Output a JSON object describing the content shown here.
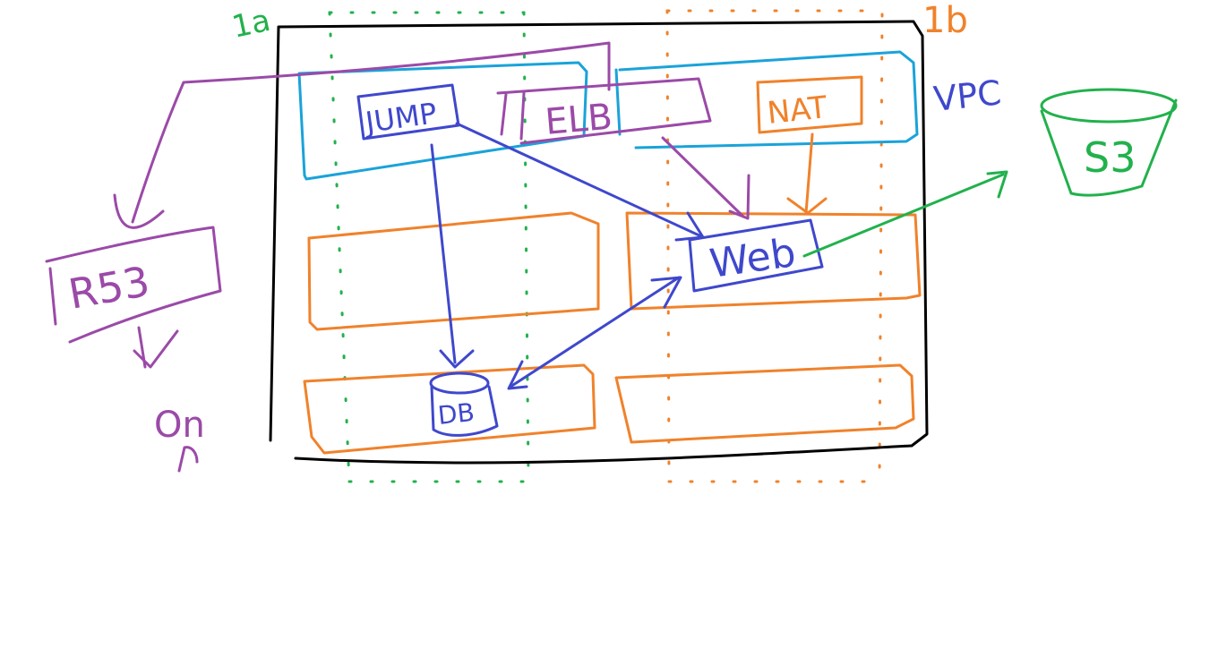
{
  "colors": {
    "black": "#000000",
    "purple": "#9b4aa8",
    "blue": "#3f48cc",
    "cyan": "#1aa3d9",
    "orange": "#f0822b",
    "green": "#22b14c"
  },
  "labels": {
    "az_a": "1a",
    "az_b": "1b",
    "vpc": "VPC",
    "jump": "JUMP",
    "elb": "ELB",
    "nat": "NAT",
    "web": "Web",
    "db": "DB",
    "r53": "R53",
    "s3": "S3",
    "on": "On"
  }
}
